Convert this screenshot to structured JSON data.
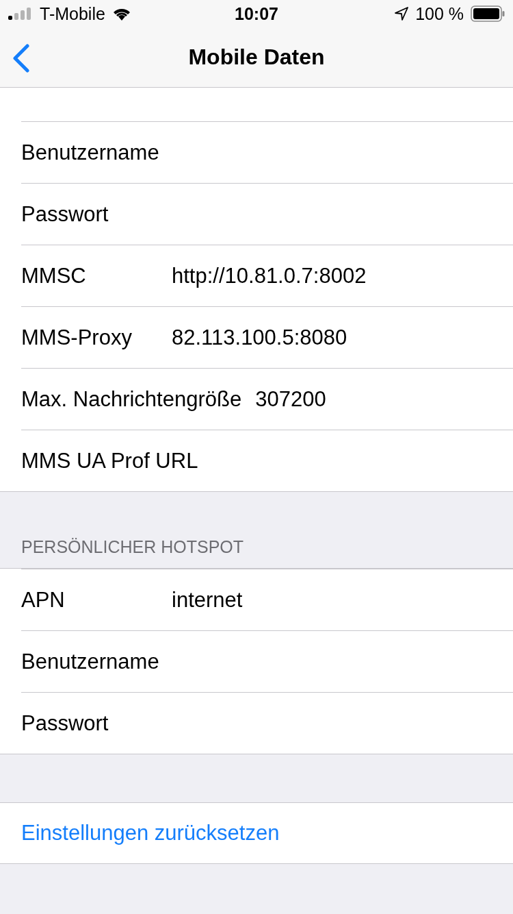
{
  "status_bar": {
    "carrier": "T-Mobile",
    "time": "10:07",
    "battery": "100 %"
  },
  "nav": {
    "title": "Mobile Daten"
  },
  "mobile_data": {
    "rows": [
      {
        "label": "Benutzername"
      },
      {
        "label": "Passwort"
      },
      {
        "label": "MMSC",
        "value": "http://10.81.0.7:8002"
      },
      {
        "label": "MMS-Proxy",
        "value": "82.113.100.5:8080"
      },
      {
        "label": "Max. Nachrichtengröße",
        "value": "307200"
      },
      {
        "label": "MMS UA Prof URL"
      }
    ]
  },
  "hotspot": {
    "header": "PERSÖNLICHER HOTSPOT",
    "rows": [
      {
        "label": "APN",
        "value": "internet"
      },
      {
        "label": "Benutzername"
      },
      {
        "label": "Passwort"
      }
    ]
  },
  "reset_button": "Einstellungen zurücksetzen"
}
